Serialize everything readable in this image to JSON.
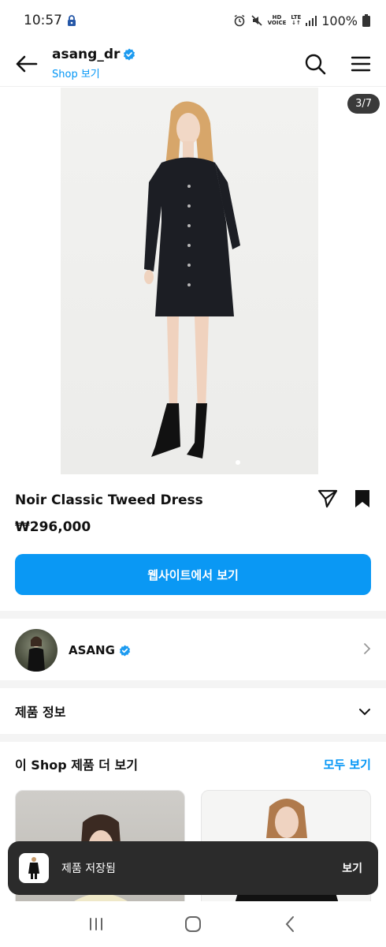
{
  "status_bar": {
    "time": "10:57",
    "network_hd": "HD",
    "network_voice": "VOICE",
    "network_lte": "LTE",
    "battery": "100%"
  },
  "header": {
    "account_name": "asang_dr",
    "shop_link": "Shop 보기",
    "icons": [
      "back-arrow-icon",
      "search-icon",
      "menu-icon"
    ]
  },
  "product": {
    "image_counter": "3/7",
    "title": "Noir Classic Tweed Dress",
    "price": "₩296,000",
    "cta_label": "웹사이트에서 보기"
  },
  "seller": {
    "name": "ASANG"
  },
  "details": {
    "label": "제품 정보"
  },
  "more_section": {
    "title": "이 Shop 제품 더 보기",
    "see_all": "모두 보기"
  },
  "snackbar": {
    "message": "제품 저장됨",
    "action": "보기"
  },
  "colors": {
    "accent": "#0095f6",
    "cta": "#0a98f4",
    "verified": "#1d9bf0",
    "snackbar": "#2b2b2b"
  }
}
